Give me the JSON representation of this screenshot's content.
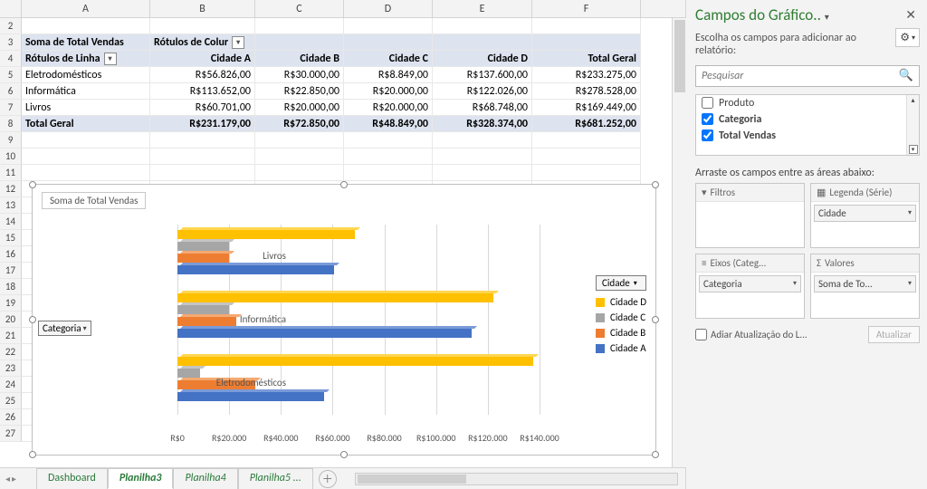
{
  "columns": [
    "A",
    "B",
    "C",
    "D",
    "E",
    "F"
  ],
  "pivot": {
    "corner_label": "Soma de Total Vendas",
    "col_label": "Rótulos de Colur",
    "row_label": "Rótulos de Linha",
    "col_headers": [
      "Cidade A",
      "Cidade B",
      "Cidade C",
      "Cidade D",
      "Total Geral"
    ],
    "rows": [
      {
        "label": "Eletrodomésticos",
        "vals": [
          "R$56.826,00",
          "R$30.000,00",
          "R$8.849,00",
          "R$137.600,00",
          "R$233.275,00"
        ]
      },
      {
        "label": "Informática",
        "vals": [
          "R$113.652,00",
          "R$22.850,00",
          "R$20.000,00",
          "R$122.026,00",
          "R$278.528,00"
        ]
      },
      {
        "label": "Livros",
        "vals": [
          "R$60.701,00",
          "R$20.000,00",
          "R$20.000,00",
          "R$68.748,00",
          "R$169.449,00"
        ]
      }
    ],
    "total_label": "Total Geral",
    "totals": [
      "R$231.179,00",
      "R$72.850,00",
      "R$48.849,00",
      "R$328.374,00",
      "R$681.252,00"
    ]
  },
  "chart_data": {
    "type": "bar",
    "orientation": "horizontal",
    "title": "Soma de Total Vendas",
    "axis_button": "Categoria",
    "legend_button": "Cidade",
    "categories": [
      "Eletrodomésticos",
      "Informática",
      "Livros"
    ],
    "series": [
      {
        "name": "Cidade D",
        "color": "#ffc000",
        "values": [
          137600,
          122026,
          68748
        ]
      },
      {
        "name": "Cidade C",
        "color": "#a6a6a6",
        "values": [
          8849,
          20000,
          20000
        ]
      },
      {
        "name": "Cidade B",
        "color": "#ed7d31",
        "values": [
          30000,
          22850,
          20000
        ]
      },
      {
        "name": "Cidade A",
        "color": "#4472c4",
        "values": [
          56826,
          113652,
          60701
        ]
      }
    ],
    "x_ticks": [
      "R$0",
      "R$20.000",
      "R$40.000",
      "R$60.000",
      "R$80.000",
      "R$100.000",
      "R$120.000",
      "R$140.000"
    ],
    "x_max": 140000,
    "ylabel": "",
    "xlabel": ""
  },
  "tabs": [
    "Dashboard",
    "Planilha3",
    "Planilha4",
    "Planilha5 ..."
  ],
  "active_tab": 1,
  "panel": {
    "title": "Campos do Gráfico..",
    "subtitle": "Escolha os campos para adicionar ao relatório:",
    "search_placeholder": "Pesquisar",
    "fields": [
      {
        "label": "Produto",
        "checked": false
      },
      {
        "label": "Categoria",
        "checked": true
      },
      {
        "label": "Total Vendas",
        "checked": true
      }
    ],
    "areas_label": "Arraste os campos entre as áreas abaixo:",
    "area_titles": {
      "filters": "Filtros",
      "legend": "Legenda (Série)",
      "axis": "Eixos (Categ...",
      "values": "Valores"
    },
    "area_items": {
      "filters": [],
      "legend": [
        "Cidade"
      ],
      "axis": [
        "Categoria"
      ],
      "values": [
        "Soma de To..."
      ]
    },
    "defer_label": "Adiar Atualização do L...",
    "update_label": "Atualizar"
  }
}
